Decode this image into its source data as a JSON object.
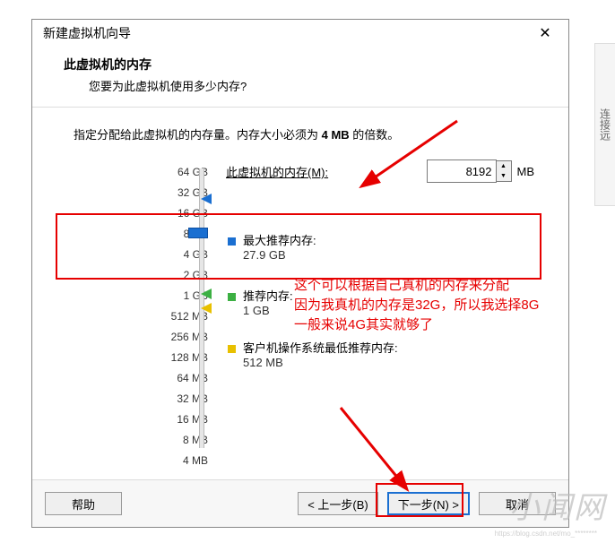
{
  "dialog": {
    "title": "新建虚拟机向导",
    "close": "✕",
    "header_title": "此虚拟机的内存",
    "header_sub": "您要为此虚拟机使用多少内存?"
  },
  "instr_pre": "指定分配给此虚拟机的内存量。内存大小必须为 ",
  "instr_bold": "4 MB",
  "instr_post": " 的倍数。",
  "mem_label": "此虚拟机的内存(M):",
  "mem_value": "8192",
  "mem_unit": "MB",
  "scale": [
    "64 GB",
    "32 GB",
    "16 GB",
    "8 GB",
    "4 GB",
    "2 GB",
    "1 GB",
    "512 MB",
    "256 MB",
    "128 MB",
    "64 MB",
    "32 MB",
    "16 MB",
    "8 MB",
    "4 MB"
  ],
  "max": {
    "label": "最大推荐内存:",
    "val": "27.9 GB"
  },
  "rec": {
    "label": "推荐内存:",
    "val": "1 GB"
  },
  "min": {
    "label": "客户机操作系统最低推荐内存:",
    "val": "512 MB"
  },
  "annot": {
    "l1": "这个可以根据自己真机的内存来分配",
    "l2": "因为我真机的内存是32G，所以我选择8G",
    "l3": "一般来说4G其实就够了"
  },
  "buttons": {
    "help": "帮助",
    "back": "< 上一步(B)",
    "next": "下一步(N) >",
    "cancel": "取消"
  },
  "side": "连接远",
  "watermark": "小闻网"
}
